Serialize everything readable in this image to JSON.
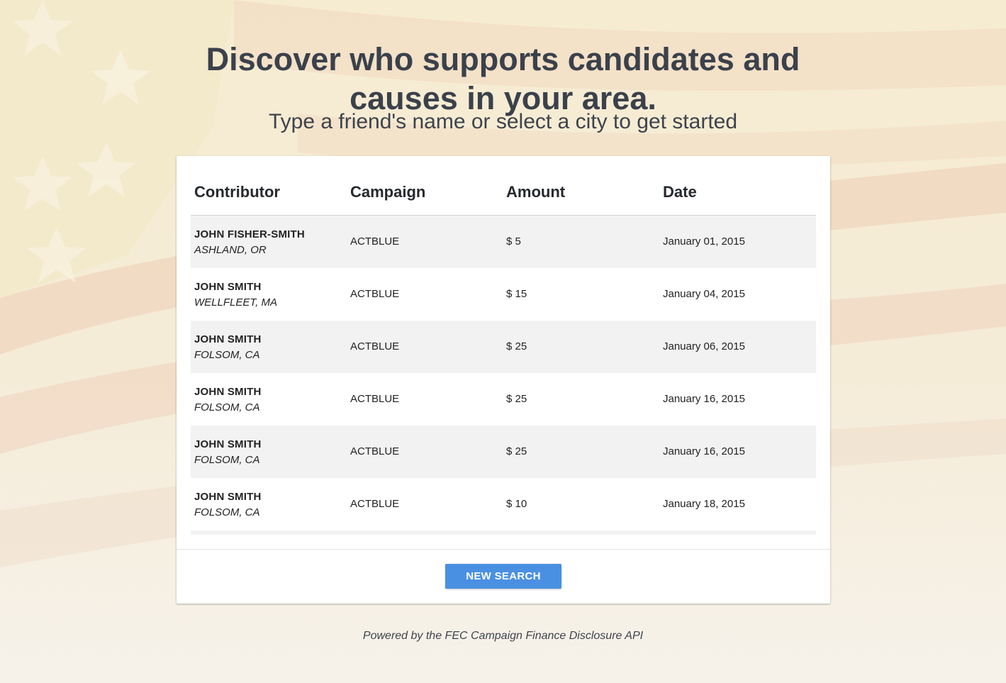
{
  "header": {
    "headline_line1": "Discover who supports candidates and",
    "headline_line2": "causes in your area.",
    "subheadline": "Type a friend's name or select a city to get started"
  },
  "table": {
    "columns": [
      "Contributor",
      "Campaign",
      "Amount",
      "Date"
    ],
    "rows": [
      {
        "name": "JOHN FISHER-SMITH",
        "place": "ASHLAND, OR",
        "campaign": "ACTBLUE",
        "amount": "$ 5",
        "date": "January 01, 2015"
      },
      {
        "name": "JOHN SMITH",
        "place": "WELLFLEET, MA",
        "campaign": "ACTBLUE",
        "amount": "$ 15",
        "date": "January 04, 2015"
      },
      {
        "name": "JOHN SMITH",
        "place": "FOLSOM, CA",
        "campaign": "ACTBLUE",
        "amount": "$ 25",
        "date": "January 06, 2015"
      },
      {
        "name": "JOHN SMITH",
        "place": "FOLSOM, CA",
        "campaign": "ACTBLUE",
        "amount": "$ 25",
        "date": "January 16, 2015"
      },
      {
        "name": "JOHN SMITH",
        "place": "FOLSOM, CA",
        "campaign": "ACTBLUE",
        "amount": "$ 25",
        "date": "January 16, 2015"
      },
      {
        "name": "JOHN SMITH",
        "place": "FOLSOM, CA",
        "campaign": "ACTBLUE",
        "amount": "$ 10",
        "date": "January 18, 2015"
      }
    ]
  },
  "actions": {
    "new_search_label": "NEW SEARCH"
  },
  "footer": {
    "powered_by": "Powered by the FEC Campaign Finance Disclosure API"
  },
  "colors": {
    "button": "#4a90e2",
    "stripe_row": "#f2f2f2",
    "background": "#f6f1e6"
  }
}
